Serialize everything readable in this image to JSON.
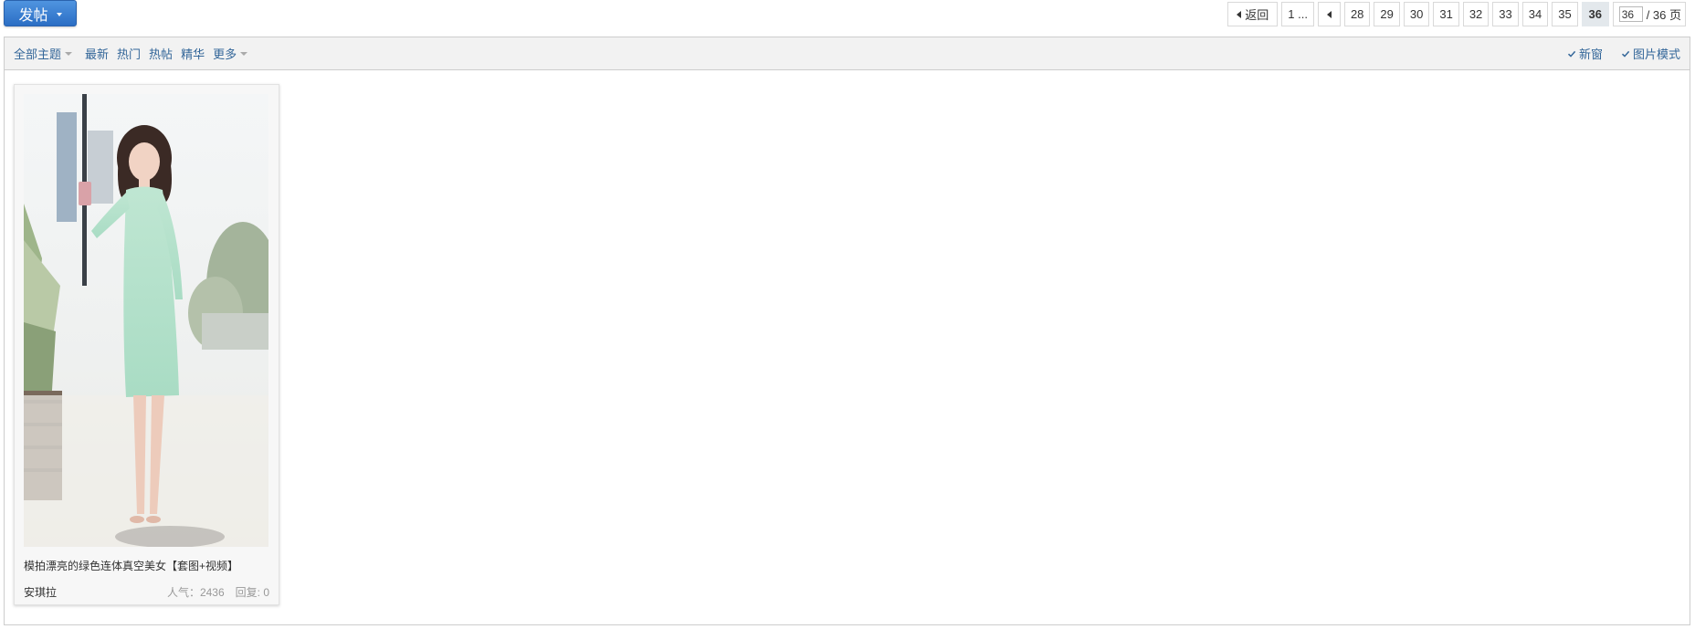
{
  "toolbar": {
    "post_label": "发帖"
  },
  "pager": {
    "back_label": "返回",
    "first_label": "1 ...",
    "pages": [
      "28",
      "29",
      "30",
      "31",
      "32",
      "33",
      "34",
      "35"
    ],
    "current": "36",
    "jump_value": "36",
    "total_label": "/ 36 页"
  },
  "filter": {
    "all_topics": "全部主题",
    "newest": "最新",
    "hot": "热门",
    "hot_posts": "热帖",
    "digest": "精华",
    "more": "更多",
    "new_window": "新窗",
    "image_mode": "图片模式"
  },
  "threads": [
    {
      "title": "模拍漂亮的绿色连体真空美女【套图+视频】",
      "author": "安琪拉",
      "popularity_label": "人气：2436",
      "replies_label": "回复: 0"
    }
  ],
  "colors": {
    "accent": "#2b6ec4",
    "link": "#336699",
    "filter_bg": "#f2f2f2"
  }
}
